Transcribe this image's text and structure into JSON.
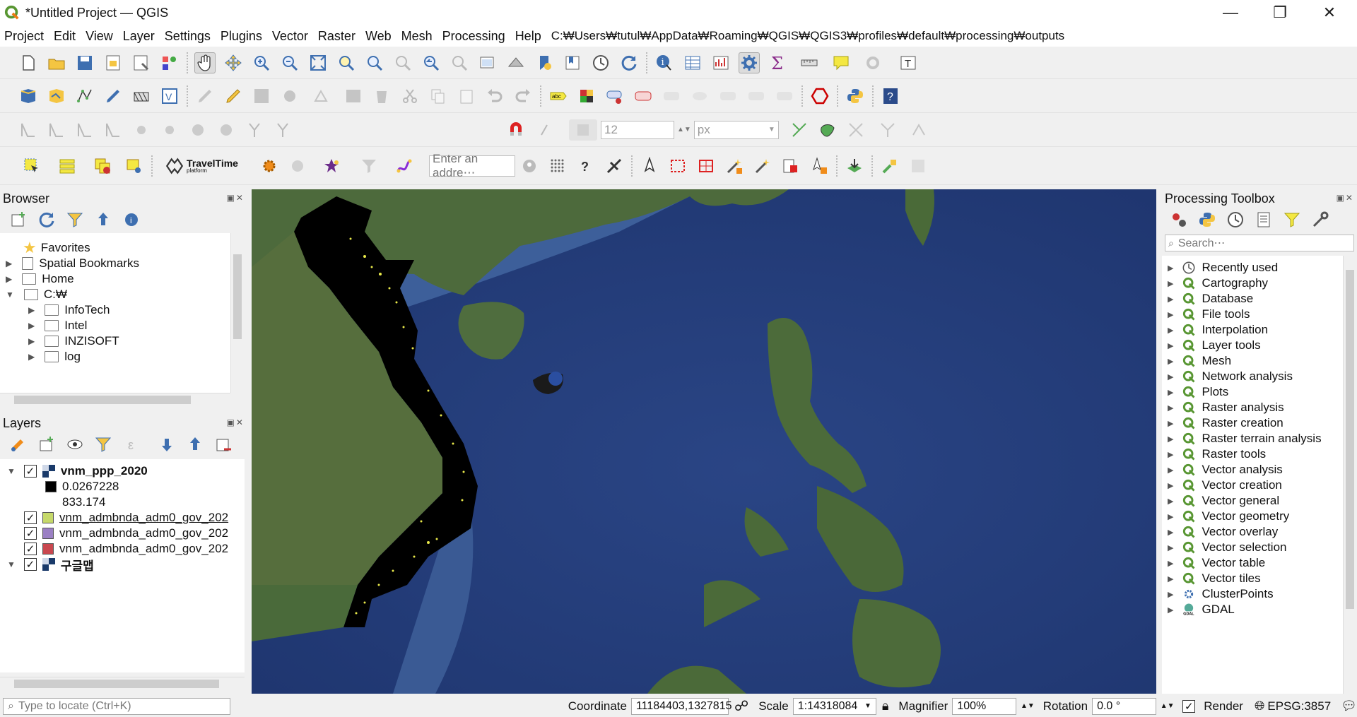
{
  "window": {
    "title": "*Untitled Project — QGIS",
    "minimize": "—",
    "restore": "❐",
    "close": "✕"
  },
  "menu": {
    "items": [
      "Project",
      "Edit",
      "View",
      "Layer",
      "Settings",
      "Plugins",
      "Vector",
      "Raster",
      "Web",
      "Mesh",
      "Processing",
      "Help"
    ],
    "path": "C:₩Users₩tutul₩AppData₩Roaming₩QGIS₩QGIS3₩profiles₩default₩processing₩outputs"
  },
  "toolbar": {
    "snapping_tolerance": "12",
    "snapping_unit": "px",
    "travel_time_label": "TravelTime",
    "travel_time_sub": "platform",
    "geocoder_placeholder": "Enter an addre⋯"
  },
  "browser": {
    "title": "Browser",
    "items": [
      {
        "label": "Favorites"
      },
      {
        "label": "Spatial Bookmarks"
      },
      {
        "label": "Home"
      },
      {
        "label": "C:₩"
      },
      {
        "label": "InfoTech"
      },
      {
        "label": "Intel"
      },
      {
        "label": "INZISOFT"
      },
      {
        "label": "log"
      }
    ]
  },
  "layers": {
    "title": "Layers",
    "items": [
      {
        "label": "vnm_ppp_2020",
        "bold": true
      },
      {
        "label": "0.0267228"
      },
      {
        "label": "833.174"
      },
      {
        "label": "vnm_admbnda_adm0_gov_202",
        "color": "#c6d96a"
      },
      {
        "label": "vnm_admbnda_adm0_gov_202",
        "color": "#9b80c4"
      },
      {
        "label": "vnm_admbnda_adm0_gov_202",
        "color": "#c9474f"
      },
      {
        "label": "구글맵",
        "bold": true
      }
    ]
  },
  "toolbox": {
    "title": "Processing Toolbox",
    "search_placeholder": "Search⋯",
    "items": [
      "Recently used",
      "Cartography",
      "Database",
      "File tools",
      "Interpolation",
      "Layer tools",
      "Mesh",
      "Network analysis",
      "Plots",
      "Raster analysis",
      "Raster creation",
      "Raster terrain analysis",
      "Raster tools",
      "Vector analysis",
      "Vector creation",
      "Vector general",
      "Vector geometry",
      "Vector overlay",
      "Vector selection",
      "Vector table",
      "Vector tiles",
      "ClusterPoints",
      "GDAL"
    ]
  },
  "status": {
    "locate_placeholder": "Type to locate (Ctrl+K)",
    "coordinate_label": "Coordinate",
    "coordinate_value": "11184403,1327815",
    "scale_label": "Scale",
    "scale_value": "1:14318084",
    "magnifier_label": "Magnifier",
    "magnifier_value": "100%",
    "rotation_label": "Rotation",
    "rotation_value": "0.0 °",
    "render_label": "Render",
    "crs": "EPSG:3857"
  },
  "colors": {
    "qgis_green": "#589632",
    "ocean": "#2b4b8a",
    "land": "#4f6a3a"
  }
}
